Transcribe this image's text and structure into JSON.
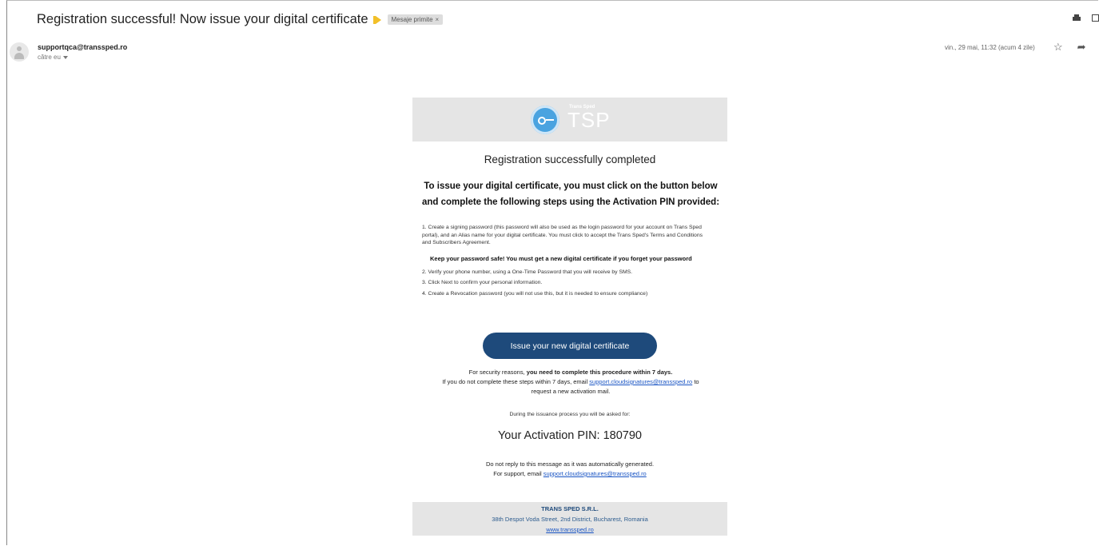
{
  "header": {
    "subject": "Registration successful! Now issue your digital certificate",
    "label_chip": "Mesaje primite",
    "label_close": "×"
  },
  "message": {
    "sender": "supportqca@transsped.ro",
    "recipient": "către eu",
    "date": "vin., 29 mai, 11:32 (acum 4 zile)",
    "icons": [
      "star-icon",
      "reply-icon",
      "more-vert-icon"
    ]
  },
  "email": {
    "logo_small": "Trans Sped",
    "logo_big": "TSP",
    "reg_title": "Registration successfully completed",
    "instructions_line1": "To issue your digital certificate, you must click on the button below",
    "instructions_line2": "and complete the following steps using the Activation PIN provided:",
    "step1": "1. Create a signing password (this password will also be used as the login password for your account on Trans Sped portal), and an Alias name for your digital certificate. You must click to accept the Trans Sped's Terms and Conditions and Subscribers Agreement.",
    "warning": "Keep your password safe! You must get a new digital certificate if you forget your password",
    "step2": "2. Verify your phone number, using a One-Time Password that you will receive by SMS.",
    "step3": "3. Click Next to confirm your personal information.",
    "step4": "4. Create a Revocation password (you will not use this, but it is needed to ensure compliance)",
    "button_label": "Issue your new digital certificate",
    "security_prefix": "For security reasons,",
    "security_bold": "you need to complete this procedure within 7 days.",
    "email_if_prefix": "If you do not complete these steps within 7 days, email",
    "support_email": "support.cloudsignatures@transsped.ro",
    "email_if_suffix": "to",
    "request_new": "request a new activation mail.",
    "asked_for": "During the issuance process you will be asked for:",
    "pin": "Your Activation PIN: 180790",
    "noreply": "Do not reply to this message as it was automatically generated.",
    "support_prefix": "For support, email",
    "support_email2": "support.cloudsignatures@transsped.ro"
  },
  "footer": {
    "company": "TRANS SPED S.R.L.",
    "address": "38th Despot Voda Street, 2nd District, Bucharest, Romania",
    "website": "www.transsped.ro"
  },
  "colors": {
    "button": "#1e4a7b",
    "link": "#1a55c4",
    "logo": "#4aa3e0",
    "band": "#e5e5e5"
  }
}
